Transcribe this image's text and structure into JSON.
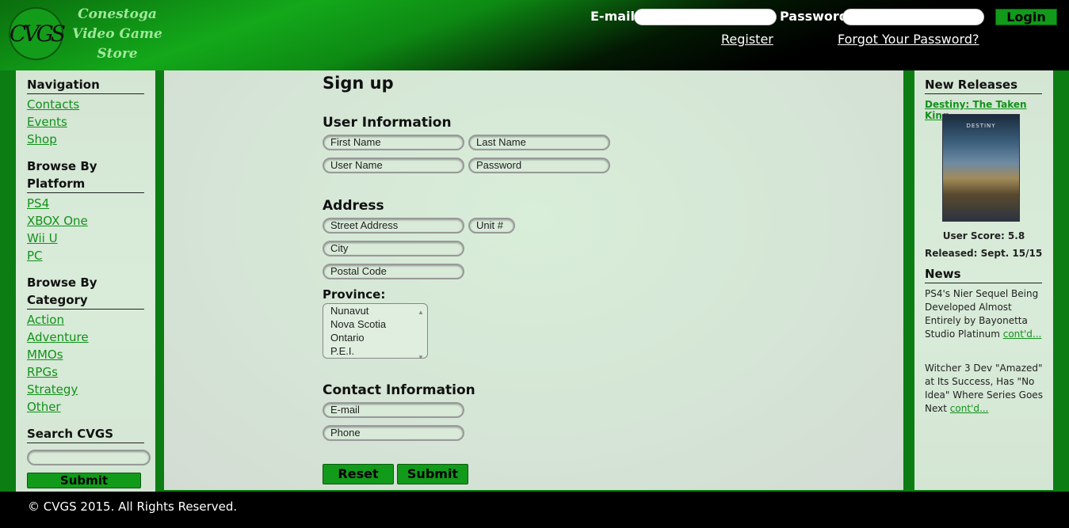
{
  "header": {
    "logo_initials": "CVGS",
    "store_name_line1": "Conestoga",
    "store_name_line2": "Video Game",
    "store_name_line3": "Store",
    "email_label": "E-mail:",
    "password_label": "Password:",
    "login_button": "Login",
    "register_link": "Register",
    "forgot_link": "Forgot Your Password?"
  },
  "sidebar": {
    "nav_heading": "Navigation",
    "nav_items": [
      "Contacts",
      "Events",
      "Shop"
    ],
    "platform_heading": "Browse By Platform",
    "platform_items": [
      "PS4",
      "XBOX One",
      "Wii U",
      "PC"
    ],
    "category_heading_line1": "Browse By",
    "category_heading_line2": "Category",
    "category_items": [
      "Action",
      "Adventure",
      "MMOs",
      "RPGs",
      "Strategy",
      "Other"
    ],
    "search_heading": "Search CVGS",
    "search_button": "Submit"
  },
  "form": {
    "title": "Sign up",
    "user_info_heading": "User Information",
    "first_name_placeholder": "First Name",
    "last_name_placeholder": "Last Name",
    "user_name_placeholder": "User Name",
    "password_placeholder": "Password",
    "address_heading": "Address",
    "street_placeholder": "Street Address",
    "unit_placeholder": "Unit #",
    "city_placeholder": "City",
    "postal_placeholder": "Postal Code",
    "province_label": "Province:",
    "province_options": [
      "Nunavut",
      "Nova Scotia",
      "Ontario",
      "P.E.I."
    ],
    "contact_heading": "Contact Information",
    "email_placeholder": "E-mail",
    "phone_placeholder": "Phone",
    "reset_button": "Reset",
    "submit_button": "Submit"
  },
  "right": {
    "releases_heading": "New Releases",
    "game_title": "Destiny: The Taken King",
    "cover_title": "DESTINY",
    "user_score": "User Score: 5.8",
    "released": "Released: Sept. 15/15",
    "news_heading": "News",
    "news1": "PS4's Nier Sequel Being Developed Almost Entirely by Bayonetta Studio Platinum",
    "news2": "Witcher 3 Dev \"Amazed\" at Its Success, Has \"No Idea\" Where Series Goes Next",
    "contd": "cont'd..."
  },
  "footer": {
    "copyright": "© CVGS 2015. All Rights Reserved."
  },
  "colors": {
    "brand_green": "#129a1a",
    "link_green": "#12911a",
    "panel_bg": "#d5e6d5"
  }
}
